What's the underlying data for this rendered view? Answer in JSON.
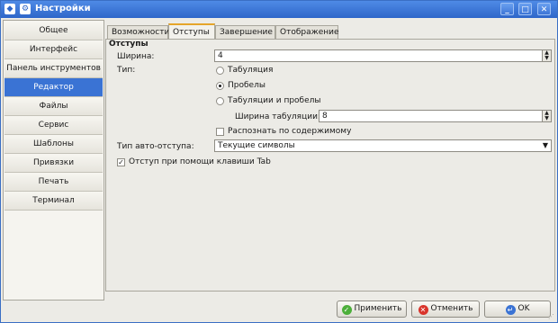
{
  "window": {
    "title": "Настройки",
    "colors": {
      "titlebar": "#3a73d4",
      "selection": "#3a73d4",
      "tab_accent": "#e5a52a"
    }
  },
  "sidebar": {
    "items": [
      {
        "label": "Общее"
      },
      {
        "label": "Интерфейс"
      },
      {
        "label": "Панель инструментов"
      },
      {
        "label": "Редактор",
        "selected": true
      },
      {
        "label": "Файлы"
      },
      {
        "label": "Сервис"
      },
      {
        "label": "Шаблоны"
      },
      {
        "label": "Привязки"
      },
      {
        "label": "Печать"
      },
      {
        "label": "Терминал"
      }
    ]
  },
  "tabs": [
    {
      "label": "Возможности"
    },
    {
      "label": "Отступы",
      "active": true
    },
    {
      "label": "Завершение"
    },
    {
      "label": "Отображение"
    }
  ],
  "indent": {
    "group_title": "Отступы",
    "width_label": "Ширина:",
    "width_value": "4",
    "type_label": "Тип:",
    "options": [
      "Табуляция",
      "Пробелы",
      "Табуляции и пробелы"
    ],
    "selected_option": "Пробелы",
    "tab_width_label": "Ширина табуляции:",
    "tab_width_value": "8",
    "detect_label": "Распознать по содержимому",
    "detect_checked": false,
    "auto_indent_label": "Тип авто-отступа:",
    "auto_indent_value": "Текущие символы",
    "tab_key_label": "Отступ при помощи клавиши Tab",
    "tab_key_checked": true
  },
  "buttons": {
    "apply": "Применить",
    "cancel": "Отменить",
    "ok": "OK"
  },
  "icons": {
    "app": "app-icon",
    "menu": "window-menu-icon",
    "minimize": "minimize-icon",
    "maximize": "maximize-icon",
    "close": "close-icon",
    "apply": "check-icon",
    "cancel": "cancel-icon",
    "ok": "enter-icon"
  }
}
